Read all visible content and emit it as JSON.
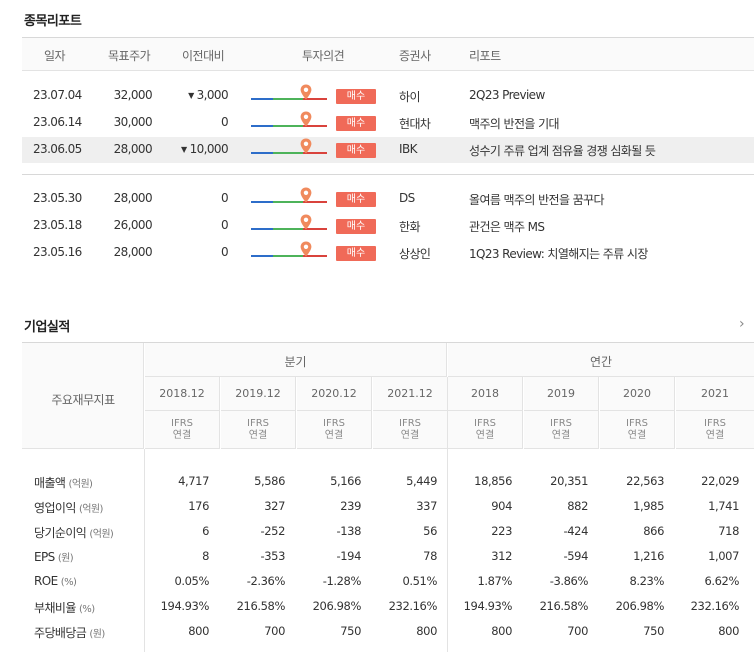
{
  "report_section": {
    "title": "종목리포트",
    "columns": [
      "일자",
      "목표주가",
      "이전대비",
      "투자의견",
      "증권사",
      "리포트"
    ],
    "rows": [
      {
        "date": "23.07.04",
        "target": "32,000",
        "change": "3,000",
        "change_dir": "down",
        "opinion": "매수",
        "firm": "하이",
        "title": "2Q23 Preview",
        "highlight": false
      },
      {
        "date": "23.06.14",
        "target": "30,000",
        "change": "0",
        "change_dir": "none",
        "opinion": "매수",
        "firm": "현대차",
        "title": "맥주의 반전을 기대",
        "highlight": false
      },
      {
        "date": "23.06.05",
        "target": "28,000",
        "change": "10,000",
        "change_dir": "down",
        "opinion": "매수",
        "firm": "IBK",
        "title": "성수기 주류 업계 점유율 경쟁 심화될 듯",
        "highlight": true
      },
      {
        "date": "23.05.30",
        "target": "28,000",
        "change": "0",
        "change_dir": "none",
        "opinion": "매수",
        "firm": "DS",
        "title": "올여름 맥주의 반전을 꿈꾸다",
        "highlight": false
      },
      {
        "date": "23.05.18",
        "target": "26,000",
        "change": "0",
        "change_dir": "none",
        "opinion": "매수",
        "firm": "한화",
        "title": "관건은 맥주 MS",
        "highlight": false
      },
      {
        "date": "23.05.16",
        "target": "28,000",
        "change": "0",
        "change_dir": "none",
        "opinion": "매수",
        "firm": "상상인",
        "title": "1Q23 Review: 치열해지는 주류 시장",
        "highlight": false
      }
    ],
    "colors": {
      "badge": "#f06a58",
      "down": "#2a55cc",
      "bar_blue": "#2d6dc9",
      "bar_green": "#4db35a",
      "bar_red": "#d9433c"
    }
  },
  "financial_section": {
    "title": "기업실적",
    "more_icon": "chevron-right-icon",
    "corner_label": "주요재무지표",
    "group_quarter": "분기",
    "group_annual": "연간",
    "years": [
      "2018.12",
      "2019.12",
      "2020.12",
      "2021.12",
      "2018",
      "2019",
      "2020",
      "2021"
    ],
    "ifrs_line1": "IFRS",
    "ifrs_line2": "연결",
    "rows": [
      {
        "label": "매출액",
        "unit": "(억원)",
        "values": [
          "4,717",
          "5,586",
          "5,166",
          "5,449",
          "18,856",
          "20,351",
          "22,563",
          "22,029"
        ]
      },
      {
        "label": "영업이익",
        "unit": "(억원)",
        "values": [
          "176",
          "327",
          "239",
          "337",
          "904",
          "882",
          "1,985",
          "1,741"
        ]
      },
      {
        "label": "당기순이익",
        "unit": "(억원)",
        "values": [
          "6",
          "-252",
          "-138",
          "56",
          "223",
          "-424",
          "866",
          "718"
        ]
      },
      {
        "label": "EPS",
        "unit": "(원)",
        "values": [
          "8",
          "-353",
          "-194",
          "78",
          "312",
          "-594",
          "1,216",
          "1,007"
        ]
      },
      {
        "label": "ROE",
        "unit": "(%)",
        "values": [
          "0.05%",
          "-2.36%",
          "-1.28%",
          "0.51%",
          "1.87%",
          "-3.86%",
          "8.23%",
          "6.62%"
        ]
      },
      {
        "label": "부채비율",
        "unit": "(%)",
        "values": [
          "194.93%",
          "216.58%",
          "206.98%",
          "232.16%",
          "194.93%",
          "216.58%",
          "206.98%",
          "232.16%"
        ]
      },
      {
        "label": "주당배당금",
        "unit": "(원)",
        "values": [
          "800",
          "700",
          "750",
          "800",
          "800",
          "700",
          "750",
          "800"
        ]
      }
    ]
  }
}
